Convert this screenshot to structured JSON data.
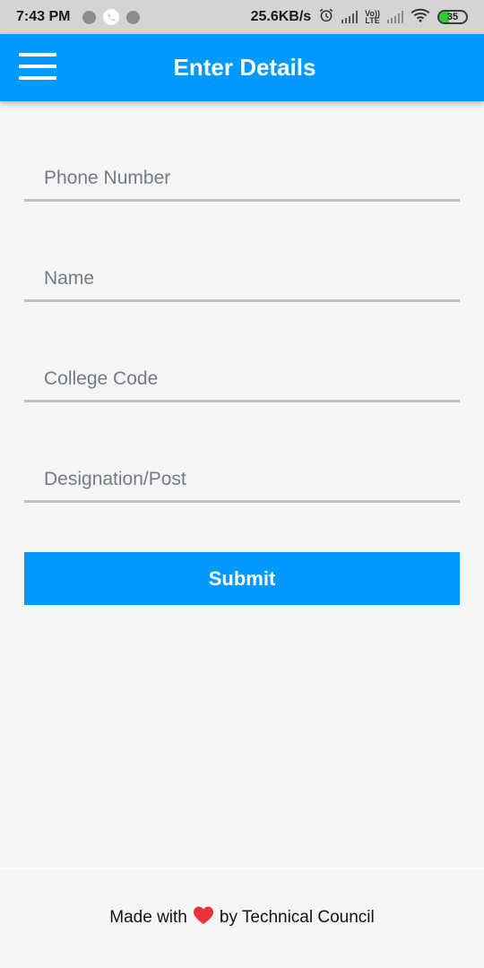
{
  "status_bar": {
    "time": "7:43 PM",
    "speed": "25.6KB/s",
    "volte_top": "Vo))",
    "volte_bottom": "LTE",
    "battery": "35",
    "battery_level": 0.35
  },
  "app_bar": {
    "title": "Enter Details",
    "menu_icon": "hamburger-menu-icon"
  },
  "form": {
    "phone": {
      "placeholder": "Phone Number",
      "value": ""
    },
    "name": {
      "placeholder": "Name",
      "value": ""
    },
    "college_code": {
      "placeholder": "College Code",
      "value": ""
    },
    "designation": {
      "placeholder": "Designation/Post",
      "value": ""
    },
    "submit_label": "Submit"
  },
  "footer": {
    "prefix": "Made with",
    "suffix": "by Technical Council",
    "heart_icon": "heart-icon"
  },
  "colors": {
    "primary": "#0099ff",
    "background": "#f7f6f4",
    "field_underline": "#b9c0c8",
    "placeholder": "#6e7c8c",
    "heart": "#e8333a"
  }
}
